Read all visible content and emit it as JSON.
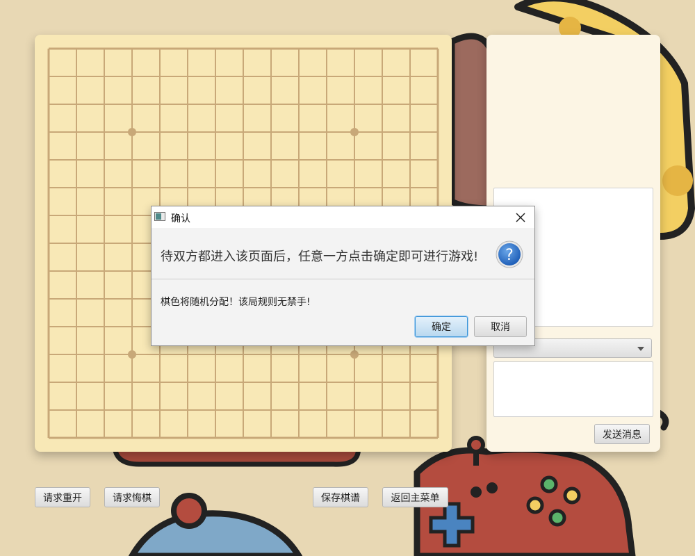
{
  "board": {
    "lines": 15,
    "star_points": [
      [
        3,
        3
      ],
      [
        11,
        3
      ],
      [
        3,
        11
      ],
      [
        11,
        11
      ]
    ],
    "colors": {
      "background": "#f8e8b6",
      "line": "#c8a878"
    }
  },
  "dialog": {
    "title": "确认",
    "header_text": "待双方都进入该页面后，任意一方点击确定即可进行游戏!",
    "content_text": "棋色将随机分配！该局规则无禁手!",
    "ok_label": "确定",
    "cancel_label": "取消",
    "icon": "question-icon"
  },
  "chat": {
    "send_label": "发送消息",
    "recipient_value": "",
    "message_value": ""
  },
  "toolbar": {
    "restart_label": "请求重开",
    "undo_label": "请求悔棋",
    "save_label": "保存棋谱",
    "main_menu_label": "返回主菜单"
  },
  "colors": {
    "page_background": "#e8d8b4",
    "accent": "#3d96d8"
  }
}
